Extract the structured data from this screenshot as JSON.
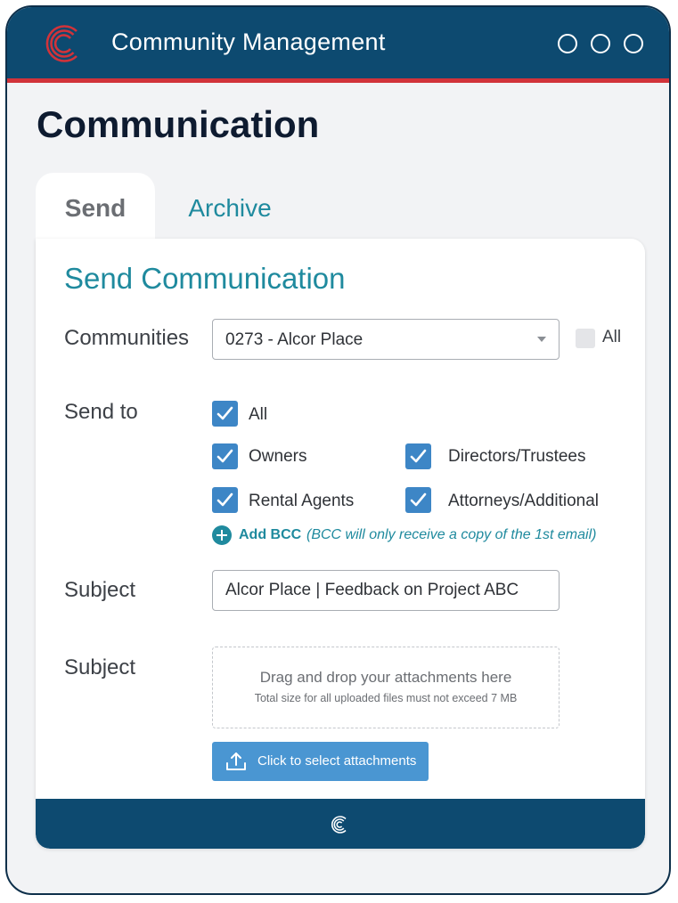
{
  "app": {
    "title": "Community Management",
    "brand_color": "#0d4a70",
    "accent_red": "#d1333a",
    "logo_icon": "community-c-logo"
  },
  "window_controls": [
    "circle",
    "circle",
    "circle"
  ],
  "page": {
    "title": "Communication"
  },
  "tabs": [
    {
      "label": "Send",
      "active": true
    },
    {
      "label": "Archive",
      "active": false
    }
  ],
  "form": {
    "title": "Send Communication",
    "communities": {
      "label": "Communities",
      "selected": "0273 - Alcor Place",
      "all_label": "All",
      "all_checked": false
    },
    "send_to": {
      "label": "Send to",
      "options": [
        {
          "label": "All",
          "checked": true
        },
        {
          "label": "Owners",
          "checked": true
        },
        {
          "label": "Directors/Trustees",
          "checked": true
        },
        {
          "label": "Rental Agents",
          "checked": true
        },
        {
          "label": "Attorneys/Additional",
          "checked": true
        }
      ]
    },
    "bcc": {
      "link_label": "Add BCC",
      "note": "(BCC will only receive a copy of the 1st email)"
    },
    "subject": {
      "label": "Subject",
      "value": "Alcor Place | Feedback on Project ABC"
    },
    "attachments": {
      "label": "Subject",
      "dropzone_title": "Drag and drop your attachments here",
      "dropzone_note": "Total size for all uploaded files must not exceed 7 MB",
      "button_label": "Click to select attachments",
      "button_icon": "upload-icon"
    }
  }
}
